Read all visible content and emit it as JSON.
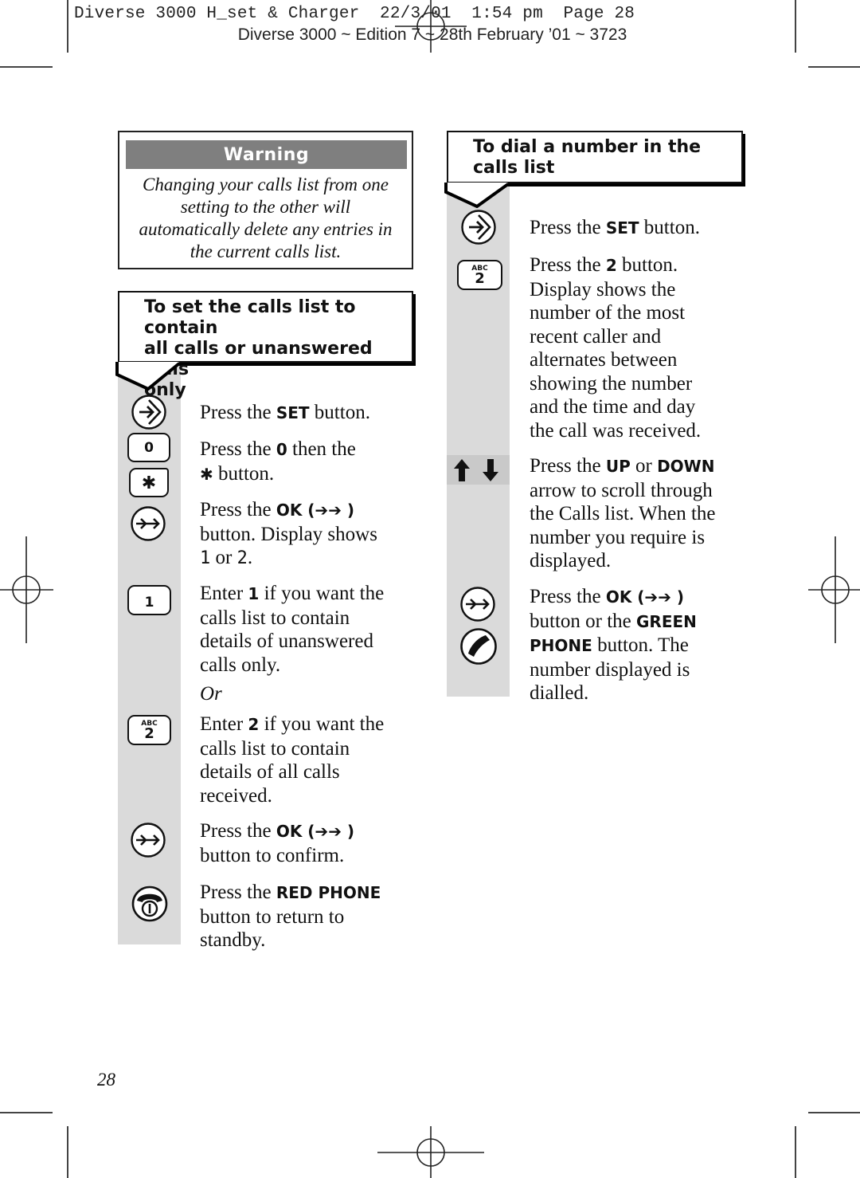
{
  "slug": {
    "line1": "Diverse 3000 H_set & Charger  22/3/01  1:54 pm  Page 28",
    "line2": "Diverse 3000 ~ Edition 7 ~ 28th February ’01 ~ 3723"
  },
  "warning": {
    "title": "Warning",
    "lines": [
      "Changing your calls list from one",
      "setting to the other will",
      "automatically delete any entries in",
      "the current calls list."
    ]
  },
  "left_section": {
    "title_lines": [
      "To set the calls list to contain",
      "all calls or unanswered calls",
      "only"
    ],
    "steps": [
      {
        "icon": "set-button-icon",
        "parts": [
          [
            "t",
            "Press the "
          ],
          [
            "b",
            "SET"
          ],
          [
            "t",
            " button."
          ]
        ]
      },
      {
        "icon": "zero-key-icon",
        "key_label": "0",
        "parts": [
          [
            "t",
            "Press the "
          ],
          [
            "b",
            "0"
          ],
          [
            "t",
            " then the"
          ],
          [
            "br",
            ""
          ],
          [
            "b",
            "✱"
          ],
          [
            "t",
            " button."
          ]
        ]
      },
      {
        "icon": "star-key-icon",
        "key_label": "✱"
      },
      {
        "icon": "ok-button-icon",
        "parts": [
          [
            "t",
            "Press the "
          ],
          [
            "b",
            "OK (➔➔ )"
          ],
          [
            "br",
            ""
          ],
          [
            "t",
            "button. Display shows"
          ],
          [
            "br",
            ""
          ],
          [
            "m",
            "1"
          ],
          [
            "t",
            " or "
          ],
          [
            "m",
            "2"
          ],
          [
            "t",
            "."
          ]
        ]
      },
      {
        "icon": "one-key-icon",
        "key_label": "1",
        "parts": [
          [
            "t",
            "Enter "
          ],
          [
            "b",
            "1"
          ],
          [
            "t",
            " if you want the"
          ],
          [
            "br",
            ""
          ],
          [
            "t",
            "calls list to contain"
          ],
          [
            "br",
            ""
          ],
          [
            "t",
            "details of unanswered"
          ],
          [
            "br",
            ""
          ],
          [
            "t",
            "calls only."
          ]
        ]
      },
      {
        "or_label": "Or"
      },
      {
        "icon": "two-key-icon",
        "key_sub": "ABC",
        "key_label": "2",
        "parts": [
          [
            "t",
            "Enter "
          ],
          [
            "b",
            "2"
          ],
          [
            "t",
            " if you want the"
          ],
          [
            "br",
            ""
          ],
          [
            "t",
            "calls list to contain"
          ],
          [
            "br",
            ""
          ],
          [
            "t",
            "details of all calls"
          ],
          [
            "br",
            ""
          ],
          [
            "t",
            "received."
          ]
        ]
      },
      {
        "icon": "ok-button-icon",
        "parts": [
          [
            "t",
            "Press the "
          ],
          [
            "b",
            "OK (➔➔ )"
          ],
          [
            "br",
            ""
          ],
          [
            "t",
            "button to confirm."
          ]
        ]
      },
      {
        "icon": "red-phone-icon",
        "parts": [
          [
            "t",
            "Press the "
          ],
          [
            "b",
            "RED PHONE"
          ],
          [
            "br",
            ""
          ],
          [
            "t",
            "button to return to"
          ],
          [
            "br",
            ""
          ],
          [
            "t",
            "standby."
          ]
        ]
      }
    ]
  },
  "right_section": {
    "title_lines": [
      "To dial a number in the",
      "calls list"
    ],
    "steps": [
      {
        "icon": "set-button-icon",
        "parts": [
          [
            "t",
            "Press the "
          ],
          [
            "b",
            "SET"
          ],
          [
            "t",
            " button."
          ]
        ]
      },
      {
        "icon": "two-key-icon",
        "key_sub": "ABC",
        "key_label": "2",
        "parts": [
          [
            "t",
            "Press the "
          ],
          [
            "b",
            "2"
          ],
          [
            "t",
            " button."
          ],
          [
            "br",
            ""
          ],
          [
            "t",
            "Display shows the"
          ],
          [
            "br",
            ""
          ],
          [
            "t",
            "number of the most"
          ],
          [
            "br",
            ""
          ],
          [
            "t",
            "recent caller and"
          ],
          [
            "br",
            ""
          ],
          [
            "t",
            "alternates between"
          ],
          [
            "br",
            ""
          ],
          [
            "t",
            "showing the number"
          ],
          [
            "br",
            ""
          ],
          [
            "t",
            "and the time and day"
          ],
          [
            "br",
            ""
          ],
          [
            "t",
            "the call was received."
          ]
        ]
      },
      {
        "icon": "up-down-arrows-icon",
        "parts": [
          [
            "t",
            "Press the "
          ],
          [
            "b",
            "UP"
          ],
          [
            "t",
            " or "
          ],
          [
            "b",
            "DOWN"
          ],
          [
            "br",
            ""
          ],
          [
            "t",
            "arrow to scroll through"
          ],
          [
            "br",
            ""
          ],
          [
            "t",
            "the Calls list. When the"
          ],
          [
            "br",
            ""
          ],
          [
            "t",
            "number you require is"
          ],
          [
            "br",
            ""
          ],
          [
            "t",
            "displayed."
          ]
        ]
      },
      {
        "icon": "ok-button-icon",
        "parts": [
          [
            "t",
            "Press the "
          ],
          [
            "b",
            "OK (➔➔ )"
          ],
          [
            "br",
            ""
          ],
          [
            "t",
            "button or the "
          ],
          [
            "b",
            "GREEN"
          ],
          [
            "br",
            ""
          ],
          [
            "b",
            "PHONE"
          ],
          [
            "t",
            " button. The"
          ],
          [
            "br",
            ""
          ],
          [
            "t",
            "number displayed is"
          ],
          [
            "br",
            ""
          ],
          [
            "t",
            "dialled."
          ]
        ]
      },
      {
        "icon": "green-phone-icon"
      }
    ]
  },
  "page_number": "28"
}
